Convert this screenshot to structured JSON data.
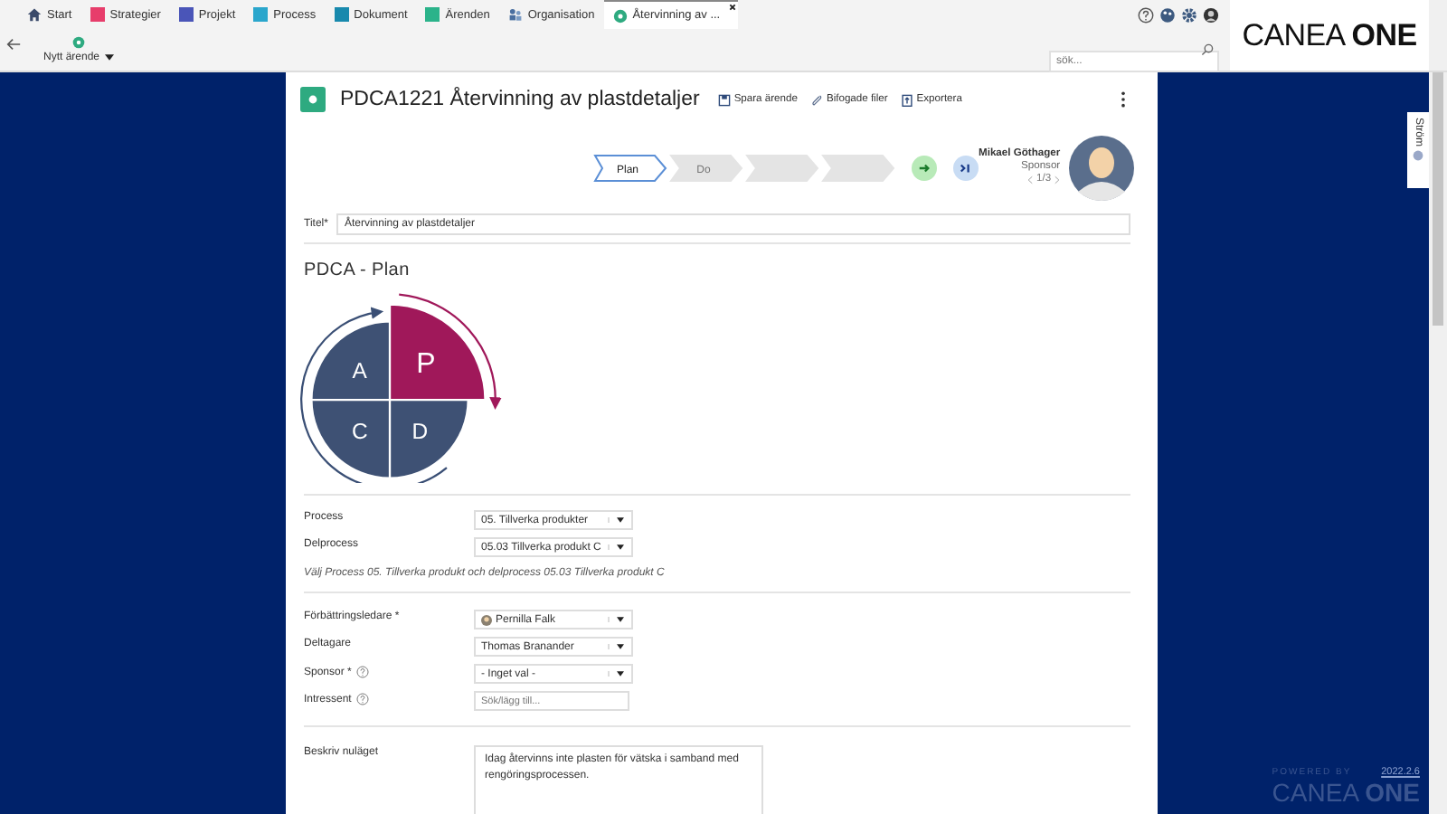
{
  "tabs": [
    {
      "label": "Start",
      "kind": "home",
      "selected": false
    },
    {
      "label": "Strategier",
      "kind": "module",
      "color": "#e73d6b",
      "selected": false
    },
    {
      "label": "Projekt",
      "kind": "module",
      "color": "#4a55b8",
      "selected": false
    },
    {
      "label": "Process",
      "kind": "module",
      "color": "#2aa6cc",
      "selected": false
    },
    {
      "label": "Dokument",
      "kind": "module",
      "color": "#1889ad",
      "selected": false
    },
    {
      "label": "Ärenden",
      "kind": "module",
      "color": "#2bb38a",
      "selected": false
    },
    {
      "label": "Organisation",
      "kind": "organisation",
      "selected": false
    },
    {
      "label": "Återvinning av ...",
      "kind": "case",
      "selected": true
    }
  ],
  "new_button": {
    "label": "Nytt ärende"
  },
  "search": {
    "placeholder": "sök..."
  },
  "logo": "CANEA **ONE**",
  "side_tab": {
    "label": "Ström"
  },
  "footer": {
    "powered_by": "POWERED BY",
    "logo": "CANEA **ONE**",
    "version": "2022.2.6"
  },
  "case": {
    "title": "PDCA1221 Återvinning av plastdetaljer",
    "actions": [
      {
        "kind": "save",
        "label": "Spara ärende"
      },
      {
        "kind": "attach",
        "label": "Bifogade filer"
      },
      {
        "kind": "export",
        "label": "Exportera"
      }
    ]
  },
  "stepper": {
    "steps": [
      {
        "label": "Plan",
        "selected": true
      },
      {
        "label": "Do",
        "selected": false
      },
      {
        "selected": false
      },
      {
        "selected": false
      }
    ]
  },
  "person": {
    "name": "Mikael Göthager",
    "role": "Sponsor",
    "pager": "1/3"
  },
  "title_field": {
    "label": "Titel*",
    "value": "Återvinning av plastdetaljer"
  },
  "pdca": {
    "title": "PDCA - Plan",
    "quadrants": [
      {
        "letter": "A",
        "selected": false
      },
      {
        "letter": "P",
        "selected": true
      },
      {
        "letter": "C",
        "selected": false
      },
      {
        "letter": "D",
        "selected": false
      }
    ]
  },
  "process_section": {
    "fields": [
      {
        "label": "Process",
        "kind": "select",
        "value": "05. Tillverka produkter",
        "help": false,
        "avatar": false
      },
      {
        "label": "Delprocess",
        "kind": "select",
        "value": "05.03 Tillverka produkt C",
        "help": false,
        "avatar": false
      }
    ],
    "hint": "Välj Process 05. Tillverka produkt och delprocess 05.03 Tillverka produkt C"
  },
  "people_section": {
    "fields": [
      {
        "label": "Förbättringsledare *",
        "kind": "select",
        "value": "Pernilla Falk",
        "help": false,
        "avatar": true
      },
      {
        "label": "Deltagare",
        "kind": "select",
        "value": "Thomas Branander",
        "help": false,
        "avatar": false
      },
      {
        "label": "Sponsor *",
        "kind": "select",
        "value": "- Inget val -",
        "help": true,
        "avatar": false
      },
      {
        "label": "Intressent",
        "kind": "input",
        "placeholder": "Sök/lägg till...",
        "help": true,
        "avatar": false
      }
    ]
  },
  "describe": {
    "label": "Beskriv nuläget",
    "value": "Idag återvinns inte plasten för vätska i samband med rengöringsprocessen."
  }
}
